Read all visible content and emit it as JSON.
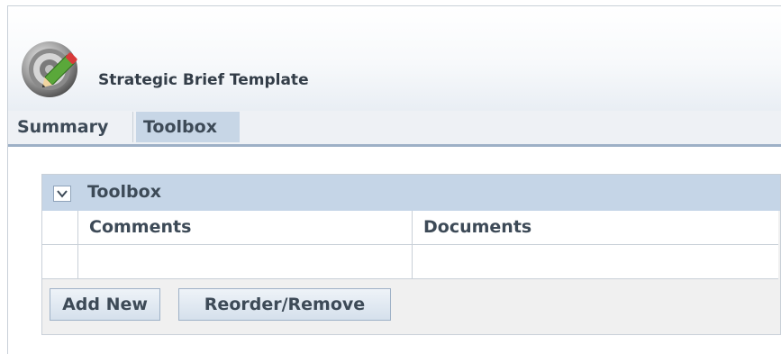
{
  "app": {
    "title": "Strategic Brief Template",
    "logo_icon": "edit-target-icon"
  },
  "tabs": [
    {
      "label": "Summary",
      "selected": false
    },
    {
      "label": "Toolbox",
      "selected": true
    }
  ],
  "panel": {
    "title": "Toolbox",
    "collapse_icon": "chevron-down-icon",
    "columns": [
      "Comments",
      "Documents"
    ],
    "rows": [
      {
        "comments": "",
        "documents": ""
      }
    ]
  },
  "buttons": {
    "add_new": "Add New",
    "reorder_remove": "Reorder/Remove"
  },
  "colors": {
    "accent_tab": "#c7d6e6",
    "panel_header": "#c5d5e7",
    "tab_underline": "#9db0c6",
    "text": "#3d4a57"
  }
}
